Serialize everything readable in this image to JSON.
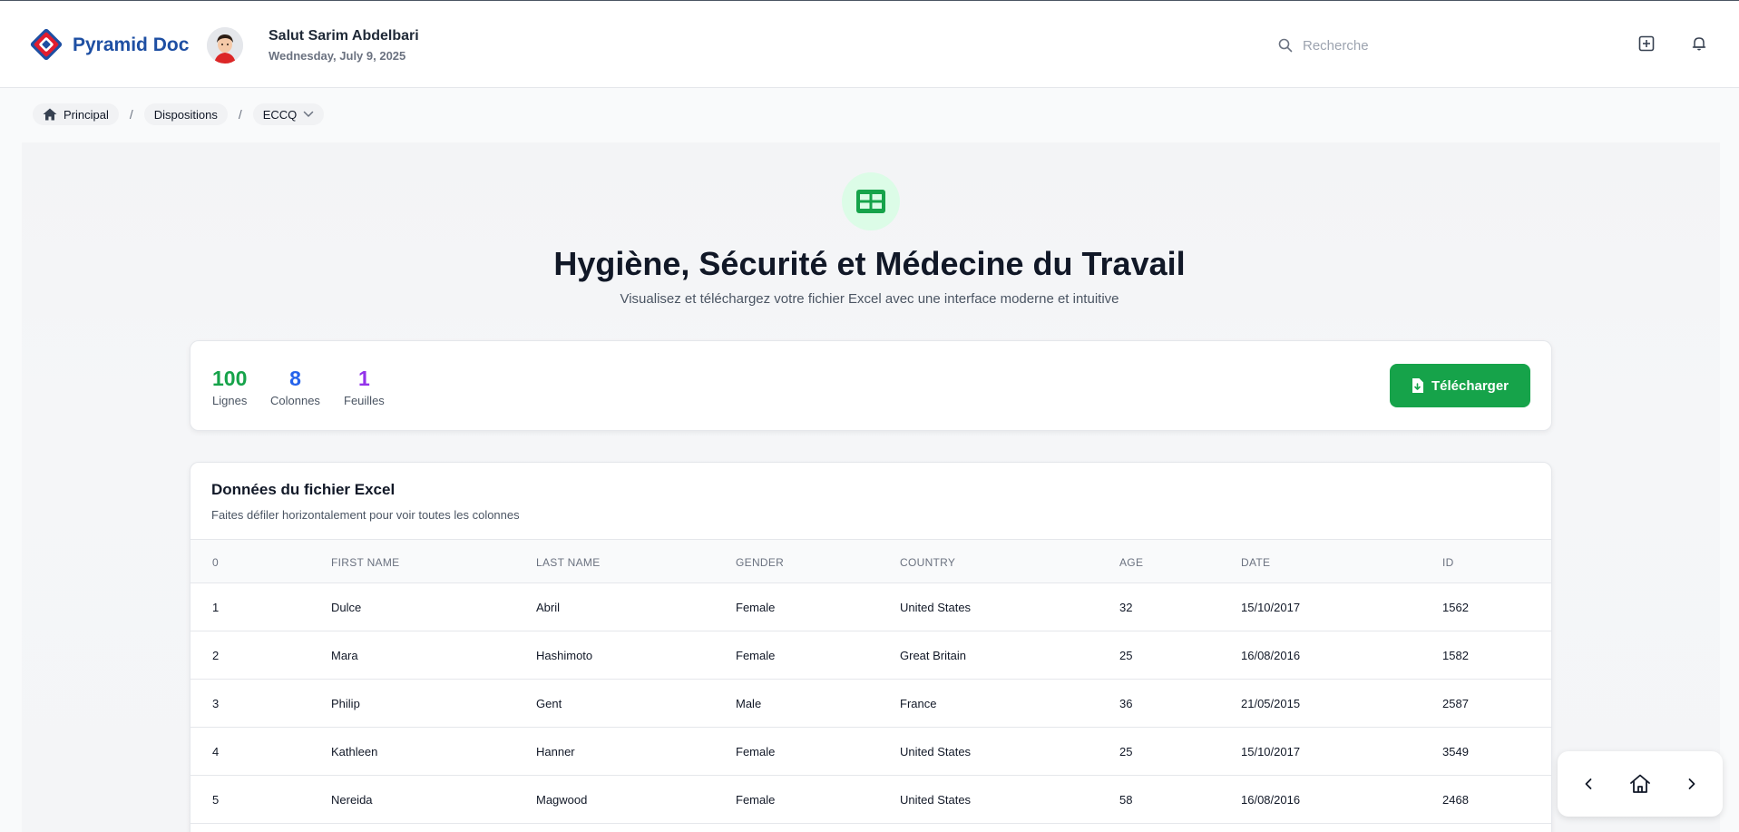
{
  "app": {
    "brand": "Pyramid Doc",
    "greeting": "Salut Sarim Abdelbari",
    "date": "Wednesday, July 9, 2025"
  },
  "search": {
    "placeholder": "Recherche",
    "value": ""
  },
  "breadcrumb": {
    "items": [
      "Principal",
      "Dispositions",
      "ECCQ"
    ],
    "separator": "/"
  },
  "hero": {
    "title": "Hygiène, Sécurité et Médecine du Travail",
    "subtitle": "Visualisez et téléchargez votre fichier Excel avec une interface moderne et intuitive"
  },
  "stats": [
    {
      "value": "100",
      "label": "Lignes",
      "color": "#16a34a"
    },
    {
      "value": "8",
      "label": "Colonnes",
      "color": "#2563eb"
    },
    {
      "value": "1",
      "label": "Feuilles",
      "color": "#9333ea"
    }
  ],
  "download_label": "Télécharger",
  "table": {
    "title": "Données du fichier Excel",
    "subtitle": "Faites défiler horizontalement pour voir toutes les colonnes",
    "columns": [
      "0",
      "FIRST NAME",
      "LAST NAME",
      "GENDER",
      "COUNTRY",
      "AGE",
      "DATE",
      "ID"
    ],
    "rows": [
      [
        "1",
        "Dulce",
        "Abril",
        "Female",
        "United States",
        "32",
        "15/10/2017",
        "1562"
      ],
      [
        "2",
        "Mara",
        "Hashimoto",
        "Female",
        "Great Britain",
        "25",
        "16/08/2016",
        "1582"
      ],
      [
        "3",
        "Philip",
        "Gent",
        "Male",
        "France",
        "36",
        "21/05/2015",
        "2587"
      ],
      [
        "4",
        "Kathleen",
        "Hanner",
        "Female",
        "United States",
        "25",
        "15/10/2017",
        "3549"
      ],
      [
        "5",
        "Nereida",
        "Magwood",
        "Female",
        "United States",
        "58",
        "16/08/2016",
        "2468"
      ]
    ]
  },
  "colors": {
    "brand": "#1e4fa3",
    "accent_green": "#16a34a",
    "logo_red": "#e11d2e"
  }
}
